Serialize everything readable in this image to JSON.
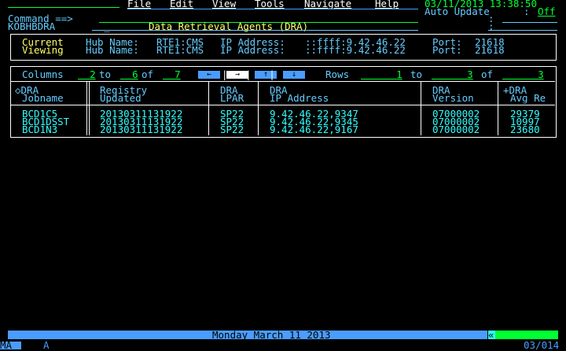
{
  "menu": {
    "items": [
      "File",
      "Edit",
      "View",
      "Tools",
      "Navigate",
      "Help"
    ],
    "datetime": "03/11/2013 13:38:50",
    "auto_update_label": "Auto Update",
    "auto_update_sep": ":",
    "auto_update_value": "Off"
  },
  "command": {
    "label": "Command ==>",
    "value": "",
    "cursor": "_"
  },
  "panel": {
    "id": "KOBHBDRA",
    "title": "Data Retrieval Agents (DRA)",
    "right_colon": ":"
  },
  "context": [
    {
      "label": "Current",
      "hub_label": "Hub Name:",
      "hub": "RTE1:CMS",
      "ip_label": "IP Address:",
      "ip": "::ffff:9.42.46.22",
      "port_label": "Port:",
      "port": "21618"
    },
    {
      "label": "Viewing",
      "hub_label": "Hub Name:",
      "hub": "RTE1:CMS",
      "ip_label": "IP Address:",
      "ip": "::ffff:9.42.46.22",
      "port_label": "Port:",
      "port": "21618"
    }
  ],
  "nav": {
    "columns_label": "Columns",
    "col_from": "2",
    "to1": "to",
    "col_to": "6",
    "of1": "of",
    "col_total": "7",
    "rows_label": "Rows",
    "row_from": "1",
    "to2": "to",
    "row_to": "3",
    "of2": "of",
    "row_total": "3",
    "arrows": [
      "←",
      "→",
      "↑",
      "↓"
    ]
  },
  "table": {
    "headers": [
      {
        "l1": "◇DRA",
        "l2": "Jobname"
      },
      {
        "l1": "Registry",
        "l2": "Updated"
      },
      {
        "l1": "DRA",
        "l2": "LPAR"
      },
      {
        "l1": "DRA",
        "l2": "IP Address"
      },
      {
        "l1": "DRA",
        "l2": "Version"
      },
      {
        "l1": "+DRA",
        "l2": "Avg Re"
      }
    ],
    "rows": [
      [
        "BCD1C5",
        "20130311131922",
        "SP22",
        "9.42.46.22,9347",
        "07000002",
        "29379"
      ],
      [
        "BCD1DSST",
        "20130311131922",
        "SP22",
        "9.42.46.22,9345",
        "07000002",
        "10997"
      ],
      [
        "BCD1N3",
        "20130311131922",
        "SP22",
        "9.42.46.22,9167",
        "07000002",
        "23680"
      ]
    ]
  },
  "status": {
    "date": "Monday March 11 2013",
    "marker": "«"
  },
  "oia": {
    "left": "MA",
    "mode": "A",
    "cursor_pos": "03/014"
  },
  "colors": {
    "green": "#00ff33",
    "turquoise": "#66ccff",
    "yellow": "#ffff66",
    "white": "#ffffff",
    "blue_bar": "#4a9dff"
  }
}
